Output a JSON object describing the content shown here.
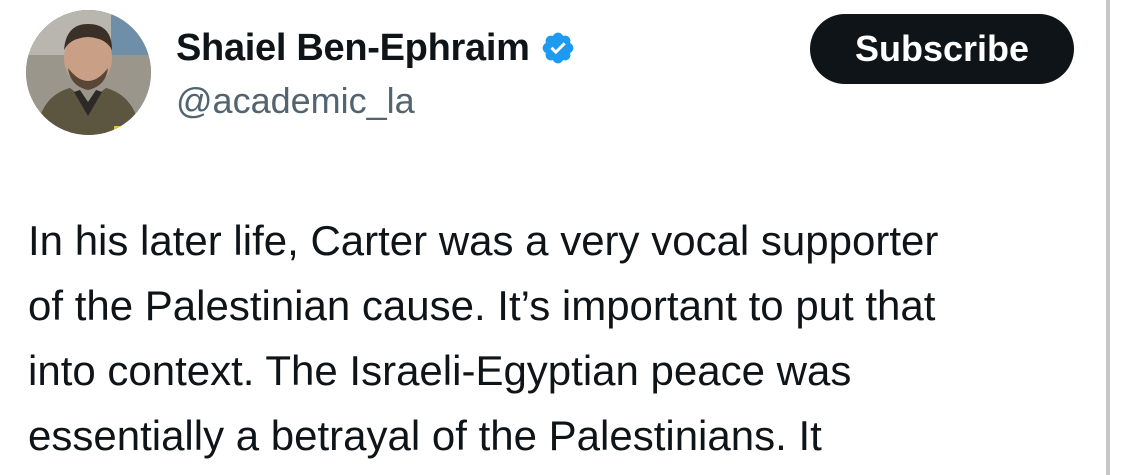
{
  "author": {
    "display_name": "Shaiel Ben-Ephraim",
    "handle": "@academic_la",
    "verified_icon": "verified-badge-icon",
    "verified_color": "#1d9bf0"
  },
  "actions": {
    "subscribe_label": "Subscribe"
  },
  "tweet": {
    "lines": [
      "In his later life, Carter was a very vocal supporter",
      "of the Palestinian cause. It’s important to put that",
      "into context. The Israeli-Egyptian peace was",
      "essentially a betrayal of the Palestinians. It"
    ]
  }
}
